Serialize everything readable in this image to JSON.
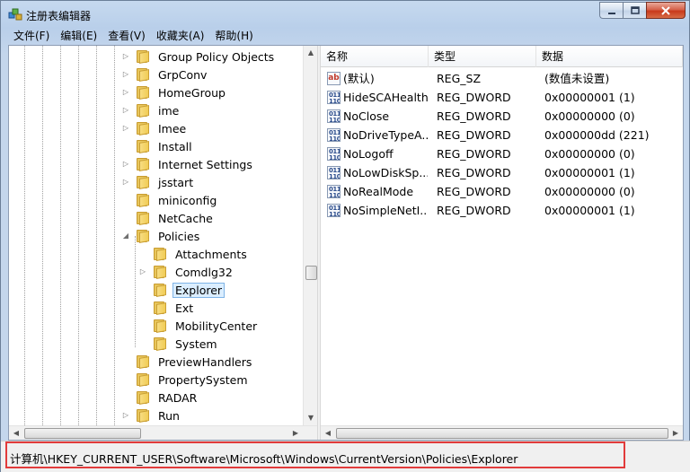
{
  "window": {
    "title": "注册表编辑器"
  },
  "menu": [
    "文件(F)",
    "编辑(E)",
    "查看(V)",
    "收藏夹(A)",
    "帮助(H)"
  ],
  "tree": {
    "items": [
      {
        "label": "Group Policy Objects",
        "level": 0,
        "expander": "collapsed"
      },
      {
        "label": "GrpConv",
        "level": 0,
        "expander": "collapsed"
      },
      {
        "label": "HomeGroup",
        "level": 0,
        "expander": "collapsed"
      },
      {
        "label": "ime",
        "level": 0,
        "expander": "collapsed"
      },
      {
        "label": "Imee",
        "level": 0,
        "expander": "collapsed"
      },
      {
        "label": "Install",
        "level": 0,
        "expander": "none"
      },
      {
        "label": "Internet Settings",
        "level": 0,
        "expander": "collapsed"
      },
      {
        "label": "jsstart",
        "level": 0,
        "expander": "collapsed"
      },
      {
        "label": "miniconfig",
        "level": 0,
        "expander": "none"
      },
      {
        "label": "NetCache",
        "level": 0,
        "expander": "none"
      },
      {
        "label": "Policies",
        "level": 0,
        "expander": "expanded"
      },
      {
        "label": "Attachments",
        "level": 1,
        "expander": "none"
      },
      {
        "label": "Comdlg32",
        "level": 1,
        "expander": "collapsed"
      },
      {
        "label": "Explorer",
        "level": 1,
        "expander": "none",
        "selected": true
      },
      {
        "label": "Ext",
        "level": 1,
        "expander": "none"
      },
      {
        "label": "MobilityCenter",
        "level": 1,
        "expander": "none"
      },
      {
        "label": "System",
        "level": 1,
        "expander": "none"
      },
      {
        "label": "PreviewHandlers",
        "level": 0,
        "expander": "none"
      },
      {
        "label": "PropertySystem",
        "level": 0,
        "expander": "none"
      },
      {
        "label": "RADAR",
        "level": 0,
        "expander": "none"
      },
      {
        "label": "Run",
        "level": 0,
        "expander": "collapsed"
      }
    ]
  },
  "list": {
    "columns": {
      "name": "名称",
      "type": "类型",
      "data": "数据"
    },
    "rows": [
      {
        "icon": "string-value-icon",
        "name": "(默认)",
        "type": "REG_SZ",
        "data": "(数值未设置)"
      },
      {
        "icon": "dword-value-icon",
        "name": "HideSCAHealth",
        "type": "REG_DWORD",
        "data": "0x00000001 (1)"
      },
      {
        "icon": "dword-value-icon",
        "name": "NoClose",
        "type": "REG_DWORD",
        "data": "0x00000000 (0)"
      },
      {
        "icon": "dword-value-icon",
        "name": "NoDriveTypeA...",
        "type": "REG_DWORD",
        "data": "0x000000dd (221)"
      },
      {
        "icon": "dword-value-icon",
        "name": "NoLogoff",
        "type": "REG_DWORD",
        "data": "0x00000000 (0)"
      },
      {
        "icon": "dword-value-icon",
        "name": "NoLowDiskSp...",
        "type": "REG_DWORD",
        "data": "0x00000001 (1)"
      },
      {
        "icon": "dword-value-icon",
        "name": "NoRealMode",
        "type": "REG_DWORD",
        "data": "0x00000000 (0)"
      },
      {
        "icon": "dword-value-icon",
        "name": "NoSimpleNetI...",
        "type": "REG_DWORD",
        "data": "0x00000001 (1)"
      }
    ]
  },
  "status": {
    "path": "计算机\\HKEY_CURRENT_USER\\Software\\Microsoft\\Windows\\CurrentVersion\\Policies\\Explorer"
  },
  "colors": {
    "highlight": "#e23b3b",
    "selection": "#dbeeff"
  }
}
